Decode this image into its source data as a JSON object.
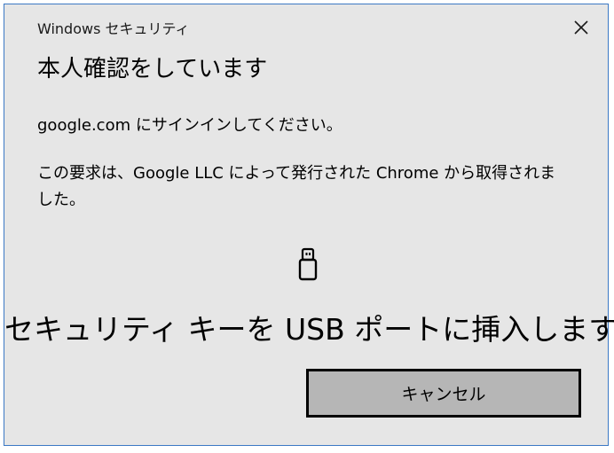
{
  "window": {
    "title": "Windows セキュリティ",
    "close_icon": "close-icon"
  },
  "main": {
    "heading": "本人確認をしています",
    "site_prompt": "google.com にサインインしてください。",
    "request_info": "この要求は、Google LLC によって発行された Chrome から取得されました。",
    "device_icon": "usb-key-icon",
    "instruction": "セキュリティ キーを USB ポートに挿入します。"
  },
  "actions": {
    "cancel_label": "キャンセル"
  },
  "colors": {
    "dialog_background": "#e6e6e6",
    "border_accent": "#3b78c4",
    "button_background": "#b6b6b6"
  }
}
